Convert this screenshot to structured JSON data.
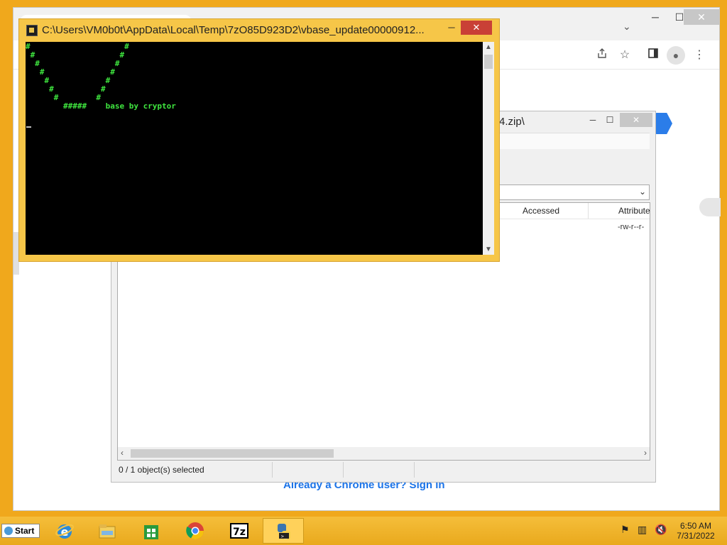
{
  "chrome": {
    "window_controls": {
      "minimize": "─",
      "maximize": "☐",
      "close": "✕"
    },
    "tab_list_chevron": "⌄",
    "toolbar_icons": [
      "share-icon",
      "star-icon",
      "side-panel-icon",
      "profile-icon",
      "menu-icon"
    ],
    "signin_text": "Already a Chrome user? Sign in"
  },
  "sevenzip": {
    "title_fragment": "4.zip\\",
    "controls": {
      "minimize": "─",
      "maximize": "☐",
      "close": "✕"
    },
    "columns": {
      "accessed": "Accessed",
      "attributes": "Attribute"
    },
    "row": {
      "attributes": "-rw-r--r-"
    },
    "status": {
      "selection": "0 / 1 object(s) selected"
    }
  },
  "console": {
    "title": "C:\\Users\\VM0b0t\\AppData\\Local\\Temp\\7zO85D923D2\\vbase_update00000912...",
    "controls": {
      "minimize": "─",
      "maximize": "☐",
      "close": "✕"
    },
    "output": "#                    #\n #                  #\n  #                #\n   #              #\n    #            #\n     #          #\n      #        #\n        #####    base by cryptor"
  },
  "taskbar": {
    "start_label": "Start",
    "apps": [
      {
        "name": "internet-explorer",
        "active": false
      },
      {
        "name": "file-explorer",
        "active": false
      },
      {
        "name": "store",
        "active": false
      },
      {
        "name": "chrome",
        "active": false
      },
      {
        "name": "7-zip",
        "active": false
      },
      {
        "name": "python",
        "active": true
      }
    ],
    "clock": {
      "time": "6:50 AM",
      "date": "7/31/2022"
    }
  },
  "colors": {
    "desktop": "#f0a81c",
    "console_frame": "#f6c648",
    "console_text": "#3fe63f",
    "close_red": "#c94036",
    "link_blue": "#1a73e8"
  }
}
